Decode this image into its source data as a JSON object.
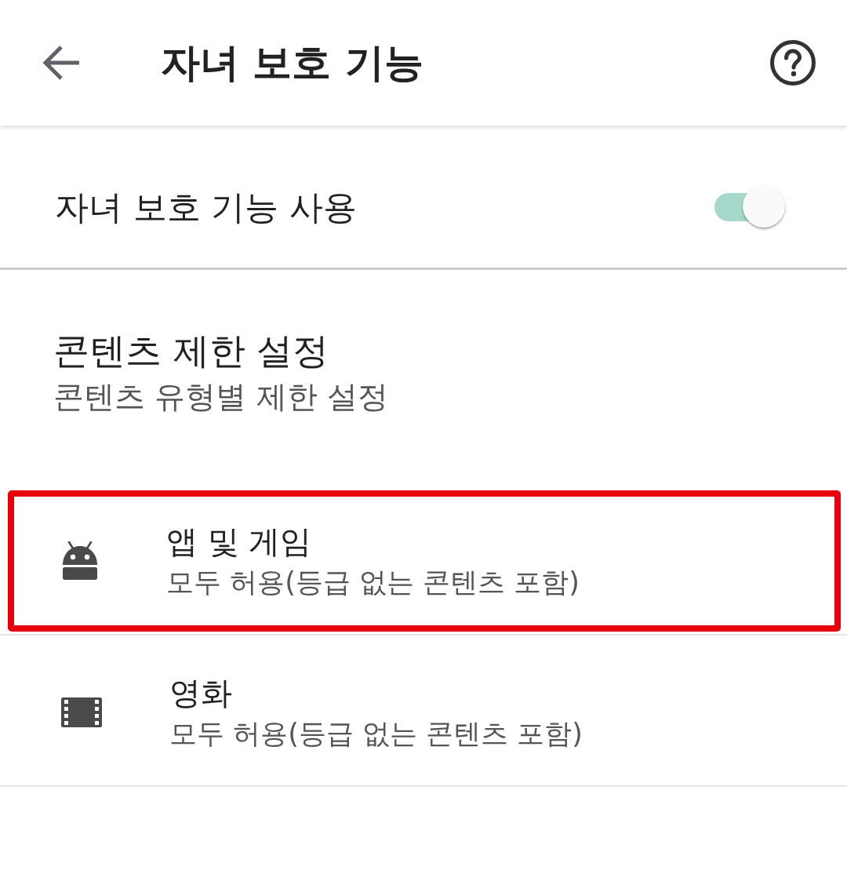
{
  "app_bar": {
    "title": "자녀 보호 기능"
  },
  "master_switch": {
    "label": "자녀 보호 기능 사용",
    "on": true
  },
  "section": {
    "title": "콘텐츠 제한 설정",
    "subtitle": "콘텐츠 유형별 제한 설정"
  },
  "items": [
    {
      "kind": "apps",
      "title": "앱 및 게임",
      "summary": "모두 허용(등급 없는 콘텐츠 포함)",
      "highlighted": true
    },
    {
      "kind": "movies",
      "title": "영화",
      "summary": "모두 허용(등급 없는 콘텐츠 포함)",
      "highlighted": false
    }
  ]
}
